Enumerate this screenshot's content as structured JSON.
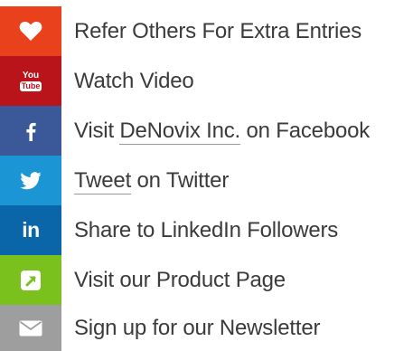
{
  "entries": [
    {
      "label": "Refer Others For Extra Entries",
      "icon": "heart-icon",
      "color": "#e8411b"
    },
    {
      "label": "Watch Video",
      "icon": "youtube-icon",
      "color": "#b8141a"
    },
    {
      "label_prefix": "Visit ",
      "label_link": "DeNovix Inc.",
      "label_suffix": " on Facebook",
      "icon": "facebook-icon",
      "color": "#3b5998"
    },
    {
      "label_link": "Tweet",
      "label_suffix": " on Twitter",
      "icon": "twitter-icon",
      "color": "#1c95d4"
    },
    {
      "label": "Share to LinkedIn Followers",
      "icon": "linkedin-icon",
      "color": "#0a66a8"
    },
    {
      "label": "Visit our Product Page",
      "icon": "external-link-icon",
      "color": "#7bc11d"
    },
    {
      "label": "Sign up for our Newsletter",
      "icon": "envelope-icon",
      "color": "#9e9e9e"
    }
  ],
  "youtube_logo": {
    "top": "You",
    "bottom": "Tube"
  },
  "linkedin_logo": "in"
}
